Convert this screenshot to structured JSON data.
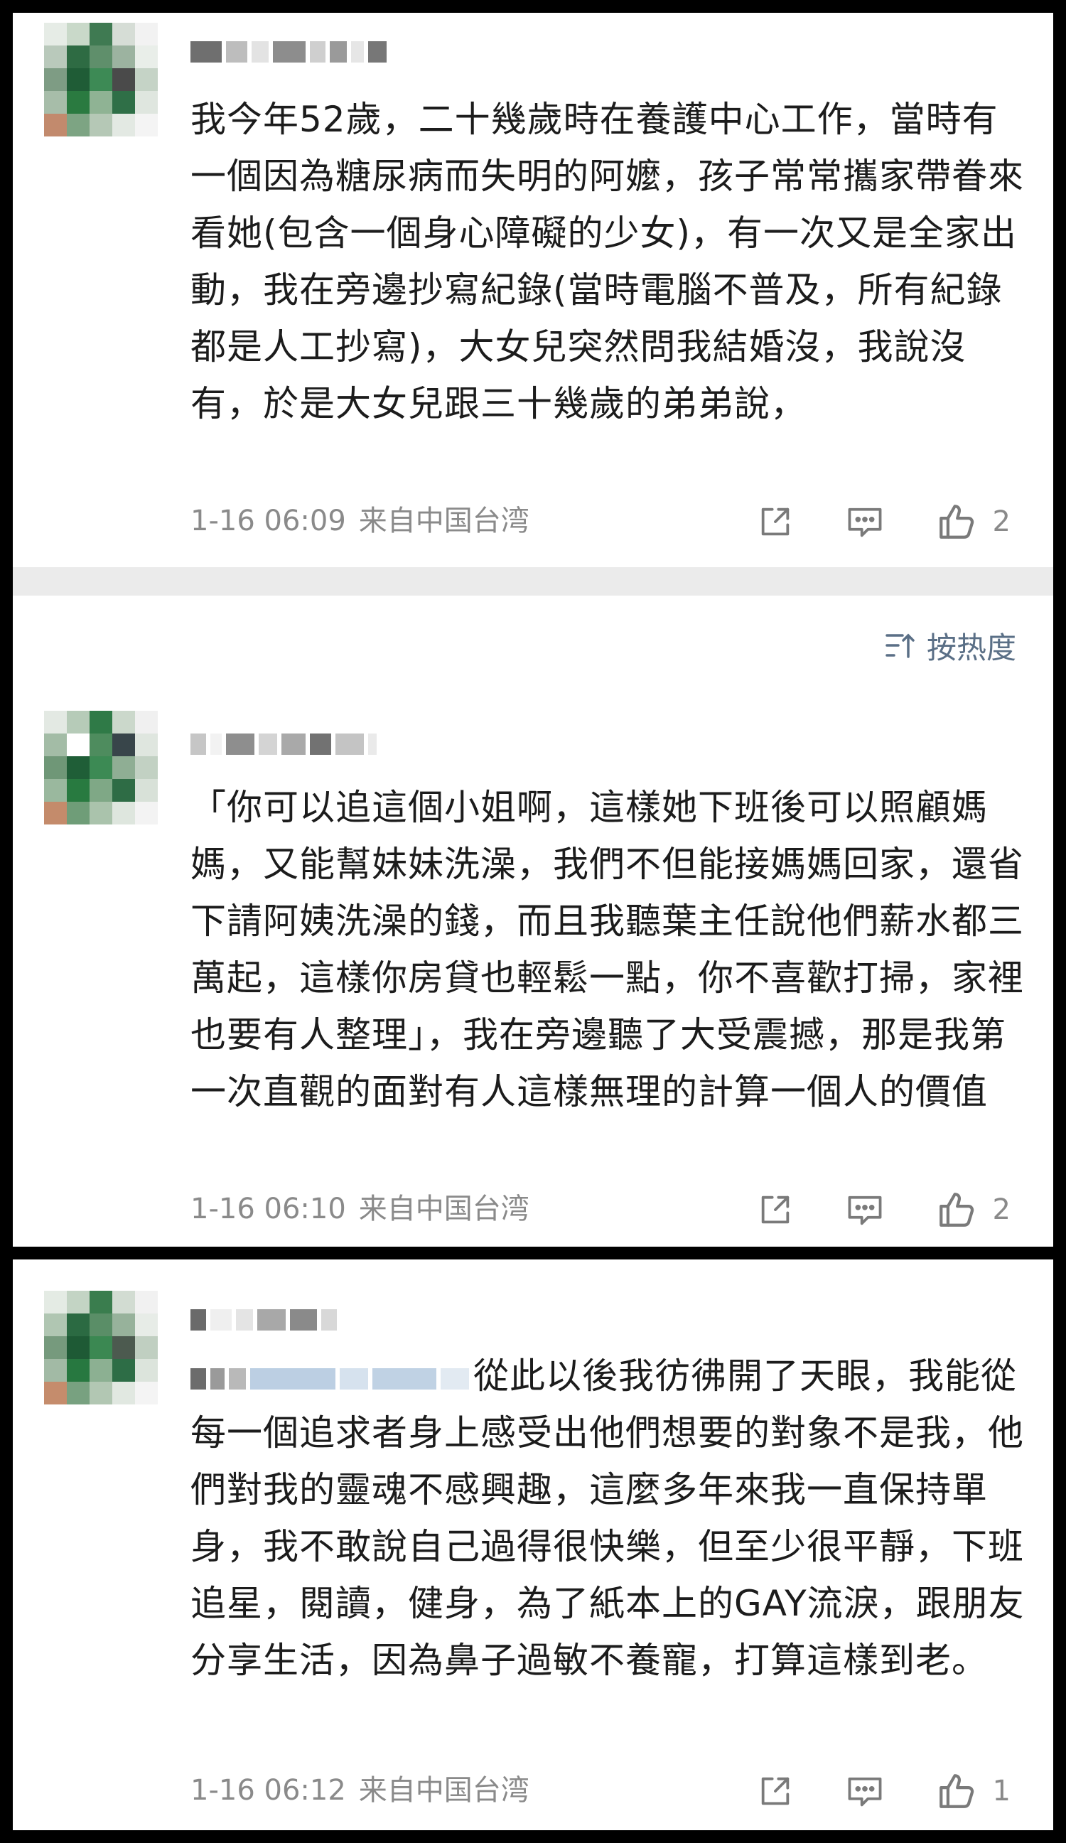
{
  "sort": {
    "label": "按热度",
    "icon": "sort-icon"
  },
  "comments": [
    {
      "text": "我今年52歲，二十幾歲時在養護中心工作，當時有一個因為糖尿病而失明的阿嬤，孩子常常攜家帶眷來看她(包含一個身心障礙的少女)，有一次又是全家出動，我在旁邊抄寫紀錄(當時電腦不普及，所有紀錄都是人工抄寫)，大女兒突然問我結婚沒，我說沒有，於是大女兒跟三十幾歲的弟弟說，",
      "time": "1-16 06:09",
      "location": "来自中国台湾",
      "likes": "2"
    },
    {
      "text": "「你可以追這個小姐啊，這樣她下班後可以照顧媽媽，又能幫妹妹洗澡，我們不但能接媽媽回家，還省下請阿姨洗澡的錢，而且我聽葉主任說他們薪水都三萬起，這樣你房貸也輕鬆一點，你不喜歡打掃，家裡也要有人整理」，我在旁邊聽了大受震撼，那是我第一次直觀的面對有人這樣無理的計算一個人的價值",
      "time": "1-16 06:10",
      "location": "来自中国台湾",
      "likes": "2"
    },
    {
      "text": "從此以後我彷彿開了天眼，我能從每一個追求者身上感受出他們想要的對象不是我，他們對我的靈魂不感興趣，這麼多年來我一直保持單身，我不敢說自己過得很快樂，但至少很平靜，下班追星，閱讀，健身，為了紙本上的GAY流淚，跟朋友分享生活，因為鼻子過敏不養寵，打算這樣到老。",
      "time": "1-16 06:12",
      "location": "来自中国台湾",
      "likes": "1"
    }
  ],
  "colors": {
    "text": "#1c1c1c",
    "meta": "#8a8a8a",
    "sort": "#5a6f86",
    "separator": "#ebebeb",
    "frame": "#000000"
  },
  "icons": {
    "share": "share-icon",
    "reply": "comment-icon",
    "like": "thumbs-up-icon"
  }
}
